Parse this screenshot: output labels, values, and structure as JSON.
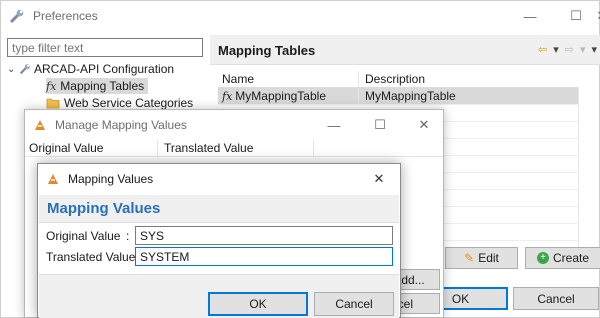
{
  "preferences": {
    "title": "Preferences",
    "filter_placeholder": "type filter text",
    "tree": [
      {
        "label": "ARCAD-API Configuration",
        "icon": "wrench-icon"
      },
      {
        "label": "Mapping Tables",
        "icon": "fx-icon"
      },
      {
        "label": "Web Service Categories",
        "icon": "folder-icon"
      }
    ],
    "section_title": "Mapping Tables",
    "table": {
      "headers": [
        "Name",
        "Description"
      ],
      "rows": [
        {
          "name": "MyMappingTable",
          "description": "MyMappingTable"
        }
      ]
    },
    "buttons": {
      "edit": "Edit",
      "create": "Create",
      "ok": "OK",
      "cancel": "Cancel"
    }
  },
  "manage_window": {
    "title": "Manage Mapping Values",
    "headers": [
      "Original Value",
      "Translated Value"
    ],
    "buttons": {
      "add": "Add...",
      "cancel_partial": "ncel"
    }
  },
  "mapping_dialog": {
    "title": "Mapping Values",
    "banner": "Mapping Values",
    "original_label": "Original Value",
    "original_colon": ":",
    "original_value": "SYS",
    "translated_label": "Translated Value :",
    "translated_value": "SYSTEM",
    "buttons": {
      "ok": "OK",
      "cancel": "Cancel"
    },
    "close_glyph": "✕"
  },
  "colors": {
    "accent": "#0078d7",
    "banner_title": "#2a6fb8"
  }
}
